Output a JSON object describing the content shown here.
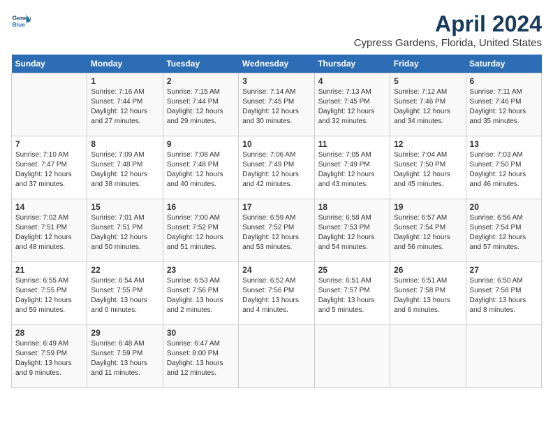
{
  "header": {
    "logo_line1": "General",
    "logo_line2": "Blue",
    "month_title": "April 2024",
    "location": "Cypress Gardens, Florida, United States"
  },
  "weekdays": [
    "Sunday",
    "Monday",
    "Tuesday",
    "Wednesday",
    "Thursday",
    "Friday",
    "Saturday"
  ],
  "weeks": [
    [
      {
        "day": "",
        "info": ""
      },
      {
        "day": "1",
        "info": "Sunrise: 7:16 AM\nSunset: 7:44 PM\nDaylight: 12 hours\nand 27 minutes."
      },
      {
        "day": "2",
        "info": "Sunrise: 7:15 AM\nSunset: 7:44 PM\nDaylight: 12 hours\nand 29 minutes."
      },
      {
        "day": "3",
        "info": "Sunrise: 7:14 AM\nSunset: 7:45 PM\nDaylight: 12 hours\nand 30 minutes."
      },
      {
        "day": "4",
        "info": "Sunrise: 7:13 AM\nSunset: 7:45 PM\nDaylight: 12 hours\nand 32 minutes."
      },
      {
        "day": "5",
        "info": "Sunrise: 7:12 AM\nSunset: 7:46 PM\nDaylight: 12 hours\nand 34 minutes."
      },
      {
        "day": "6",
        "info": "Sunrise: 7:11 AM\nSunset: 7:46 PM\nDaylight: 12 hours\nand 35 minutes."
      }
    ],
    [
      {
        "day": "7",
        "info": "Sunrise: 7:10 AM\nSunset: 7:47 PM\nDaylight: 12 hours\nand 37 minutes."
      },
      {
        "day": "8",
        "info": "Sunrise: 7:09 AM\nSunset: 7:48 PM\nDaylight: 12 hours\nand 38 minutes."
      },
      {
        "day": "9",
        "info": "Sunrise: 7:08 AM\nSunset: 7:48 PM\nDaylight: 12 hours\nand 40 minutes."
      },
      {
        "day": "10",
        "info": "Sunrise: 7:06 AM\nSunset: 7:49 PM\nDaylight: 12 hours\nand 42 minutes."
      },
      {
        "day": "11",
        "info": "Sunrise: 7:05 AM\nSunset: 7:49 PM\nDaylight: 12 hours\nand 43 minutes."
      },
      {
        "day": "12",
        "info": "Sunrise: 7:04 AM\nSunset: 7:50 PM\nDaylight: 12 hours\nand 45 minutes."
      },
      {
        "day": "13",
        "info": "Sunrise: 7:03 AM\nSunset: 7:50 PM\nDaylight: 12 hours\nand 46 minutes."
      }
    ],
    [
      {
        "day": "14",
        "info": "Sunrise: 7:02 AM\nSunset: 7:51 PM\nDaylight: 12 hours\nand 48 minutes."
      },
      {
        "day": "15",
        "info": "Sunrise: 7:01 AM\nSunset: 7:51 PM\nDaylight: 12 hours\nand 50 minutes."
      },
      {
        "day": "16",
        "info": "Sunrise: 7:00 AM\nSunset: 7:52 PM\nDaylight: 12 hours\nand 51 minutes."
      },
      {
        "day": "17",
        "info": "Sunrise: 6:59 AM\nSunset: 7:52 PM\nDaylight: 12 hours\nand 53 minutes."
      },
      {
        "day": "18",
        "info": "Sunrise: 6:58 AM\nSunset: 7:53 PM\nDaylight: 12 hours\nand 54 minutes."
      },
      {
        "day": "19",
        "info": "Sunrise: 6:57 AM\nSunset: 7:54 PM\nDaylight: 12 hours\nand 56 minutes."
      },
      {
        "day": "20",
        "info": "Sunrise: 6:56 AM\nSunset: 7:54 PM\nDaylight: 12 hours\nand 57 minutes."
      }
    ],
    [
      {
        "day": "21",
        "info": "Sunrise: 6:55 AM\nSunset: 7:55 PM\nDaylight: 12 hours\nand 59 minutes."
      },
      {
        "day": "22",
        "info": "Sunrise: 6:54 AM\nSunset: 7:55 PM\nDaylight: 13 hours\nand 0 minutes."
      },
      {
        "day": "23",
        "info": "Sunrise: 6:53 AM\nSunset: 7:56 PM\nDaylight: 13 hours\nand 2 minutes."
      },
      {
        "day": "24",
        "info": "Sunrise: 6:52 AM\nSunset: 7:56 PM\nDaylight: 13 hours\nand 4 minutes."
      },
      {
        "day": "25",
        "info": "Sunrise: 6:51 AM\nSunset: 7:57 PM\nDaylight: 13 hours\nand 5 minutes."
      },
      {
        "day": "26",
        "info": "Sunrise: 6:51 AM\nSunset: 7:58 PM\nDaylight: 13 hours\nand 6 minutes."
      },
      {
        "day": "27",
        "info": "Sunrise: 6:50 AM\nSunset: 7:58 PM\nDaylight: 13 hours\nand 8 minutes."
      }
    ],
    [
      {
        "day": "28",
        "info": "Sunrise: 6:49 AM\nSunset: 7:59 PM\nDaylight: 13 hours\nand 9 minutes."
      },
      {
        "day": "29",
        "info": "Sunrise: 6:48 AM\nSunset: 7:59 PM\nDaylight: 13 hours\nand 11 minutes."
      },
      {
        "day": "30",
        "info": "Sunrise: 6:47 AM\nSunset: 8:00 PM\nDaylight: 13 hours\nand 12 minutes."
      },
      {
        "day": "",
        "info": ""
      },
      {
        "day": "",
        "info": ""
      },
      {
        "day": "",
        "info": ""
      },
      {
        "day": "",
        "info": ""
      }
    ]
  ]
}
